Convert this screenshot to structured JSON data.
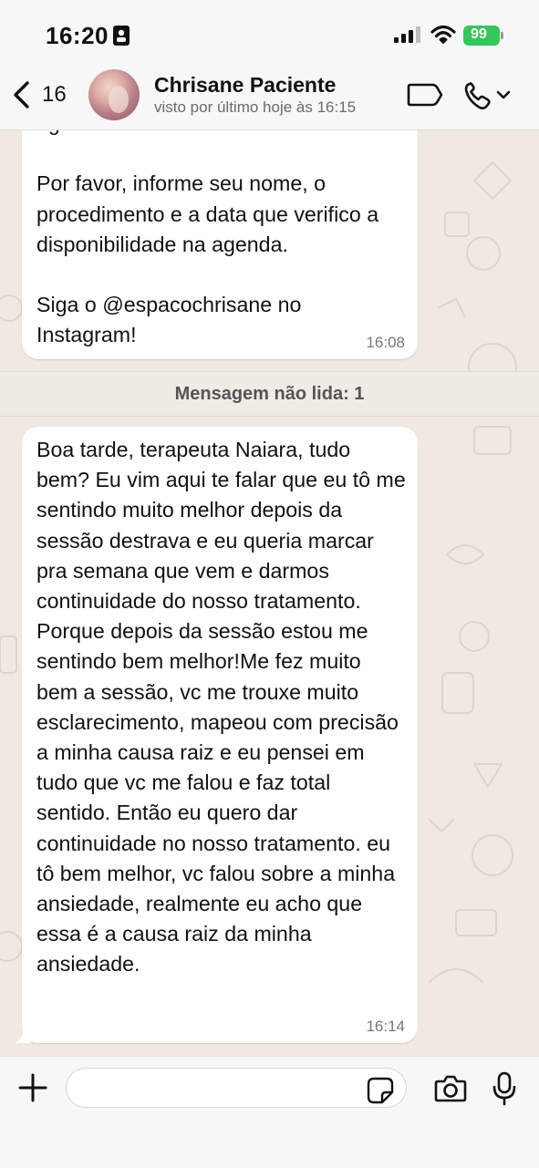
{
  "status_bar": {
    "time": "16:20",
    "battery": "99",
    "icons": [
      "id-card-icon",
      "signal-icon",
      "wifi-icon",
      "battery-icon"
    ]
  },
  "header": {
    "back_count": "16",
    "contact_name": "Chrisane Paciente",
    "contact_status": "visto por último hoje às 16:15",
    "icons": [
      "chevron-left-icon",
      "avatar",
      "label-tag-icon",
      "phone-icon",
      "chevron-down-icon"
    ]
  },
  "messages": [
    {
      "text": "agendamento?\n\nPor favor, informe seu nome, o procedimento e a data que verifico a disponibilidade na agenda.\n\nSiga o @espacochrisane no Instagram!",
      "time": "16:08"
    },
    {
      "text": "Boa tarde, terapeuta Naiara, tudo bem? Eu vim aqui te falar que eu tô me sentindo muito melhor depois da sessão destrava e eu queria marcar pra semana que vem e darmos continuidade do nosso tratamento. Porque depois da sessão estou me sentindo bem melhor!Me fez muito bem a sessão, vc me trouxe muito esclarecimento, mapeou com precisão a minha causa raiz e eu pensei em tudo que vc me falou e faz total sentido. Então eu quero dar continuidade no nosso tratamento. eu tô bem melhor, vc falou sobre a minha ansiedade, realmente eu acho que essa é a causa raiz da minha ansiedade.",
      "time": "16:14"
    }
  ],
  "unread_label": "Mensagem não lida: 1",
  "input": {
    "value": "",
    "placeholder": "",
    "icons": [
      "plus-icon",
      "sticker-icon",
      "camera-icon",
      "microphone-icon"
    ]
  },
  "colors": {
    "battery": "#34c759",
    "bubble": "#ffffff",
    "wallpaper": "#efe9e1"
  }
}
